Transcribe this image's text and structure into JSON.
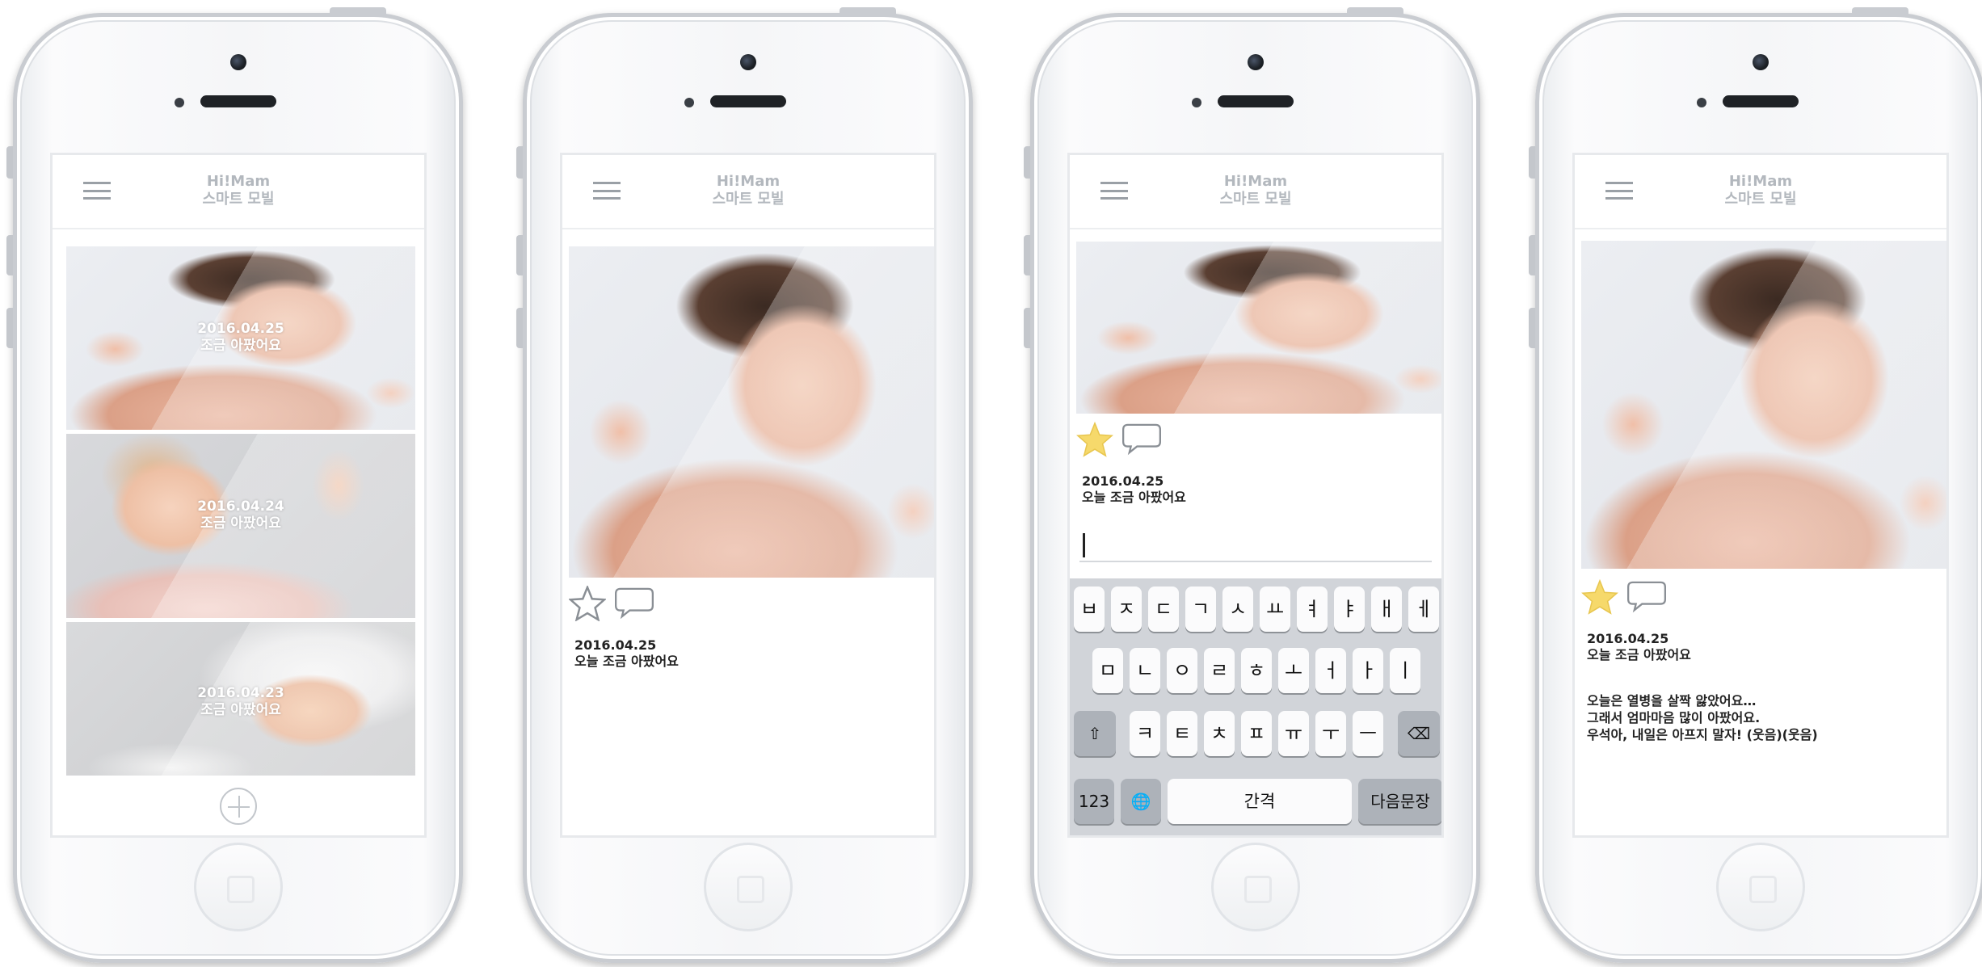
{
  "app": {
    "title_line1": "Hi!Mam",
    "title_line2": "스마트 모빌"
  },
  "screen1": {
    "feed": [
      {
        "date": "2016.04.25",
        "caption": "조금 아팠어요"
      },
      {
        "date": "2016.04.24",
        "caption": "조금 아팠어요"
      },
      {
        "date": "2016.04.23",
        "caption": "조금 아팠어요"
      }
    ]
  },
  "screen2": {
    "date": "2016.04.25",
    "caption": "오늘 조금 아팠어요"
  },
  "screen3": {
    "date": "2016.04.25",
    "caption": "오늘 조금 아팠어요",
    "keyboard": {
      "row1": [
        "ㅂ",
        "ㅈ",
        "ㄷ",
        "ㄱ",
        "ㅅ",
        "ㅛ",
        "ㅕ",
        "ㅑ",
        "ㅐ",
        "ㅔ"
      ],
      "row2": [
        "ㅁ",
        "ㄴ",
        "ㅇ",
        "ㄹ",
        "ㅎ",
        "ㅗ",
        "ㅓ",
        "ㅏ",
        "ㅣ"
      ],
      "row3": [
        "ㅋ",
        "ㅌ",
        "ㅊ",
        "ㅍ",
        "ㅠ",
        "ㅜ",
        "ㅡ"
      ],
      "shift": "⇧",
      "backspace": "⌫",
      "numbers": "123",
      "globe": "🌐",
      "space": "간격",
      "next": "다음문장"
    }
  },
  "screen4": {
    "date": "2016.04.25",
    "caption": "오늘 조금 아팠어요",
    "body": [
      "오늘은 열병을 살짝 앓았어요…",
      "그래서 엄마마음 많이 아팠어요.",
      "우석아, 내일은 아프지 말자! (웃음)(웃음)"
    ]
  },
  "colors": {
    "star_filled": "#f6d96b",
    "star_outline": "#8a8f95",
    "accent": "#b3b8be"
  }
}
